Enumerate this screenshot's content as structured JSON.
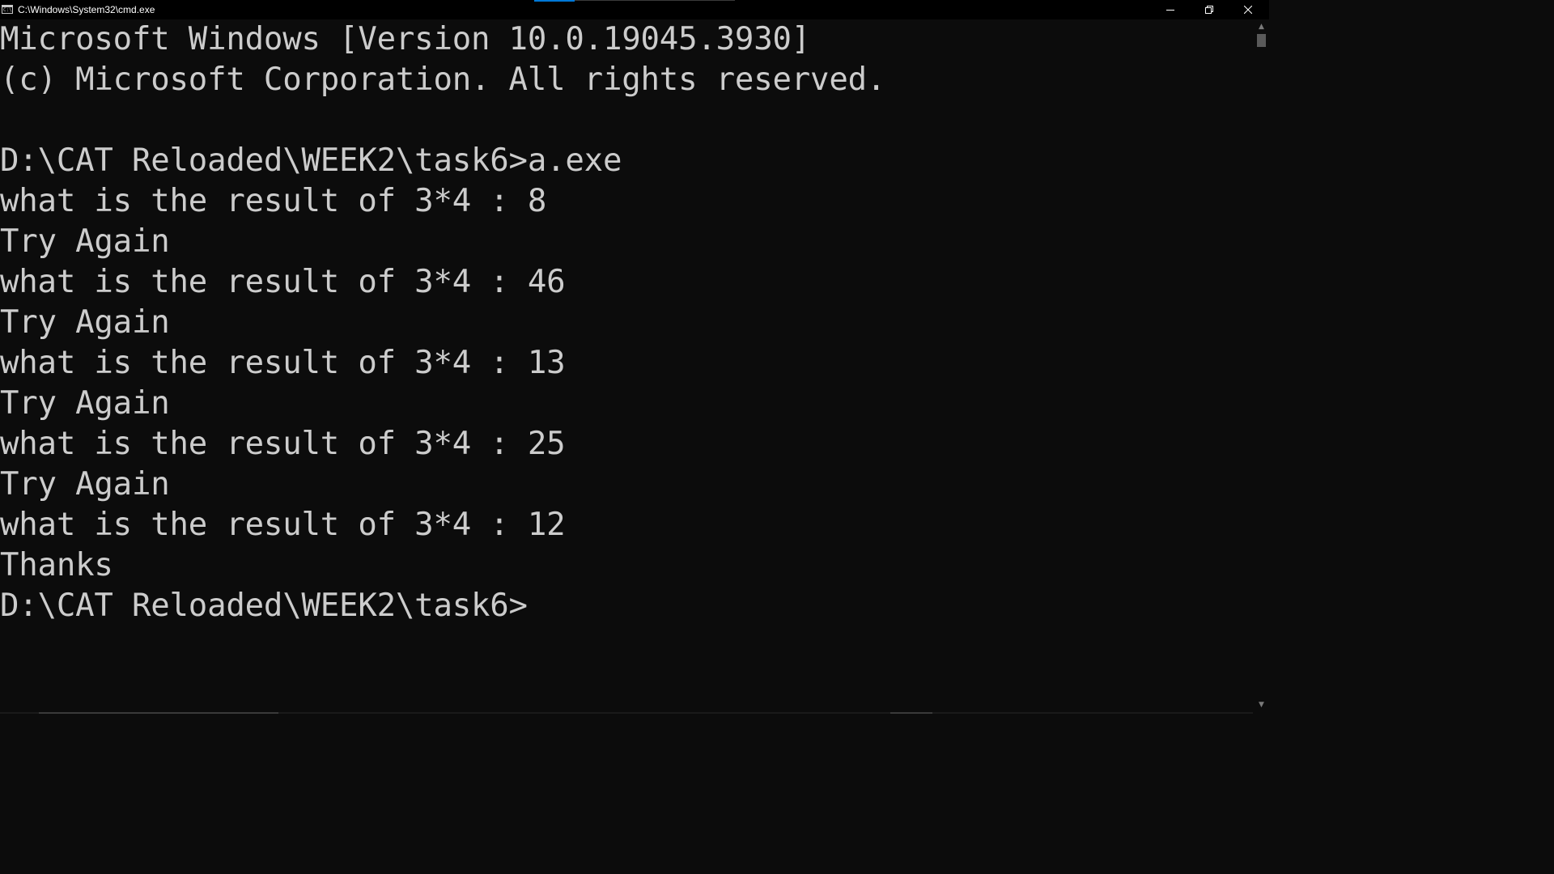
{
  "window": {
    "title": "C:\\Windows\\System32\\cmd.exe",
    "icon": "cmd-icon",
    "controls": {
      "minimize": "minimize-icon",
      "restore": "restore-icon",
      "close": "close-icon"
    }
  },
  "console": {
    "lines": [
      "Microsoft Windows [Version 10.0.19045.3930]",
      "(c) Microsoft Corporation. All rights reserved.",
      "",
      "D:\\CAT Reloaded\\WEEK2\\task6>a.exe",
      "what is the result of 3*4 : 8",
      "Try Again",
      "what is the result of 3*4 : 46",
      "Try Again",
      "what is the result of 3*4 : 13",
      "Try Again",
      "what is the result of 3*4 : 25",
      "Try Again",
      "what is the result of 3*4 : 12",
      "Thanks",
      "D:\\CAT Reloaded\\WEEK2\\task6>"
    ]
  },
  "colors": {
    "background": "#0c0c0c",
    "text": "#cccccc",
    "titlebar": "#000000",
    "accent": "#0078d7"
  }
}
